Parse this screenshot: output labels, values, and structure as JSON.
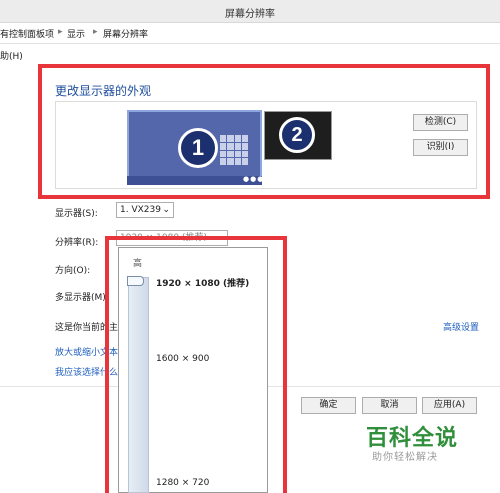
{
  "window": {
    "title": "屏幕分辨率"
  },
  "breadcrumb": {
    "item1": "有控制面板项",
    "item2": "显示",
    "item3": "屏幕分辨率",
    "separator": "▸"
  },
  "menu": {
    "help": "助(H)"
  },
  "main": {
    "heading": "更改显示器的外观",
    "monitor1_number": "1",
    "monitor2_number": "2",
    "detect_button": "检测(C)",
    "identify_button": "识别(I)",
    "display_label": "显示器(S):",
    "display_value": "1. VX239",
    "resolution_label": "分辨率(R):",
    "resolution_value": "1920 × 1080 (推荐)",
    "orientation_label": "方向(O):",
    "multi_display_label": "多显示器(M):",
    "current_display_text": "这是你当前的主",
    "advanced_link": "高级设置",
    "enlarge_link": "放大或缩小文本",
    "choose_link": "我应该选择什么"
  },
  "footer": {
    "ok_button": "确定",
    "cancel_button": "取消",
    "apply_button": "应用(A)"
  },
  "resolution_popup": {
    "high_label": "高",
    "options": [
      "1920 × 1080 (推荐)",
      "1600 × 900",
      "1280 × 720"
    ]
  },
  "watermark": {
    "main": "百科全说",
    "sub": "助你轻松解决"
  },
  "colors": {
    "accent": "#1f4e9c",
    "highlight_box": "#e8343b",
    "monitor": "#5467aa",
    "watermark": "#2f8f3a"
  }
}
